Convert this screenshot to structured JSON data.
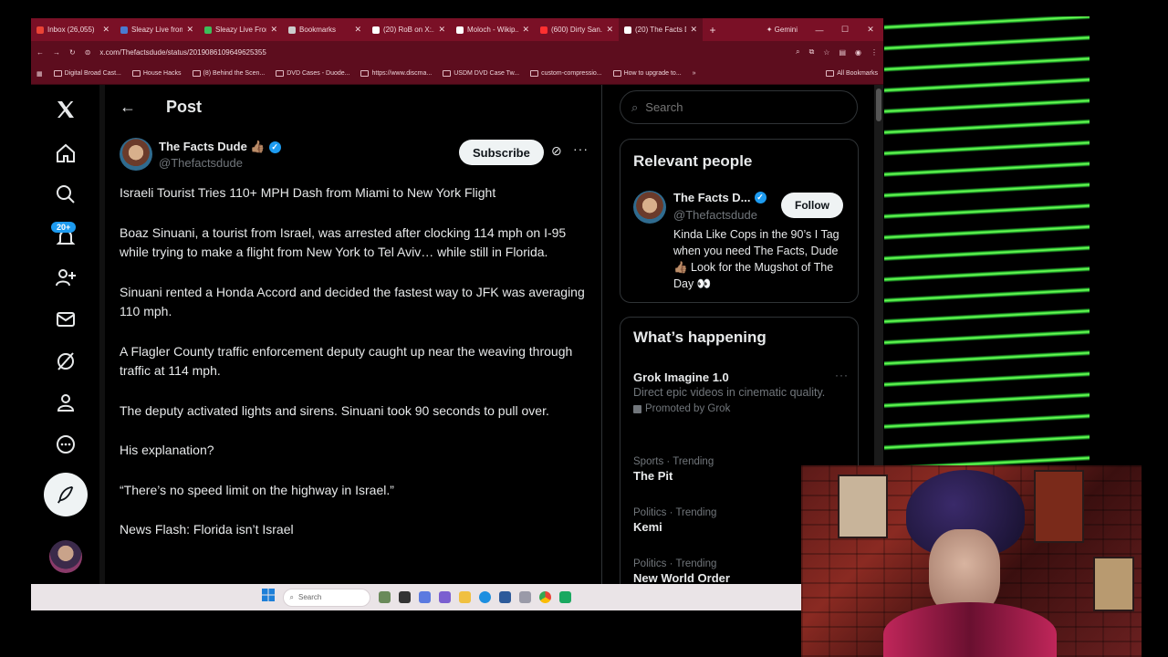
{
  "browser": {
    "tabs": [
      {
        "label": "Inbox (26,055)",
        "color": "#ea4335"
      },
      {
        "label": "Sleazy Live from...",
        "color": "#4a7bd0"
      },
      {
        "label": "Sleazy Live From...",
        "color": "#3dbd5a"
      },
      {
        "label": "Bookmarks",
        "color": "#cccccc"
      },
      {
        "label": "(20) RoB on X:...",
        "color": "#ffffff"
      },
      {
        "label": "Moloch - Wikip...",
        "color": "#ffffff"
      },
      {
        "label": "(600) Dirty San...",
        "color": "#ff3030"
      },
      {
        "label": "(20) The Facts D...",
        "color": "#ffffff"
      }
    ],
    "gemini_label": "Gemini",
    "url": "x.com/Thefactsdude/status/2019086109649625355",
    "bookmarks": [
      "Digital Broad Cast...",
      "House Hacks",
      "(8) Behind the Scen...",
      "DVD Cases - Duode...",
      "https://www.discma...",
      "USDM DVD Case Tw...",
      "custom-compressio...",
      "How to upgrade to..."
    ],
    "all_bookmarks": "All Bookmarks"
  },
  "nav": {
    "notification_badge": "20+"
  },
  "post": {
    "header": "Post",
    "author_name": "The Facts Dude 👍🏽",
    "author_handle": "@Thefactsdude",
    "subscribe_label": "Subscribe",
    "paragraphs": [
      "Israeli Tourist Tries 110+ MPH Dash from Miami to New York Flight",
      "Boaz Sinuani, a tourist from Israel, was arrested after clocking 114 mph on I-95 while trying to make a flight from New York to Tel Aviv… while still in Florida.",
      "Sinuani rented a Honda Accord and decided the fastest way to JFK was averaging 110 mph.",
      "A Flagler County traffic enforcement deputy caught up near the weaving through traffic at 114 mph.",
      "The deputy activated lights and sirens. Sinuani took 90 seconds to pull over.",
      "His explanation?",
      "“There’s no speed limit on the highway in Israel.”",
      "News Flash: Florida isn’t Israel"
    ]
  },
  "sidebar": {
    "search_placeholder": "Search",
    "relevant_title": "Relevant people",
    "rel_name": "The Facts D...",
    "rel_handle": "@Thefactsdude",
    "follow_label": "Follow",
    "rel_bio": "Kinda Like Cops in the 90’s I Tag when you need The Facts, Dude 👍🏽 Look for the Mugshot of The Day 👀",
    "happening_title": "What’s happening",
    "trends": [
      {
        "title": "Grok Imagine 1.0",
        "desc": "Direct epic videos in cinematic quality.",
        "promo": "Promoted by Grok"
      },
      {
        "meta": "Sports · Trending",
        "title": "The Pit"
      },
      {
        "meta": "Politics · Trending",
        "title": "Kemi"
      },
      {
        "meta": "Politics · Trending",
        "title": "New World Order"
      }
    ]
  },
  "taskbar": {
    "search_label": "Search"
  }
}
